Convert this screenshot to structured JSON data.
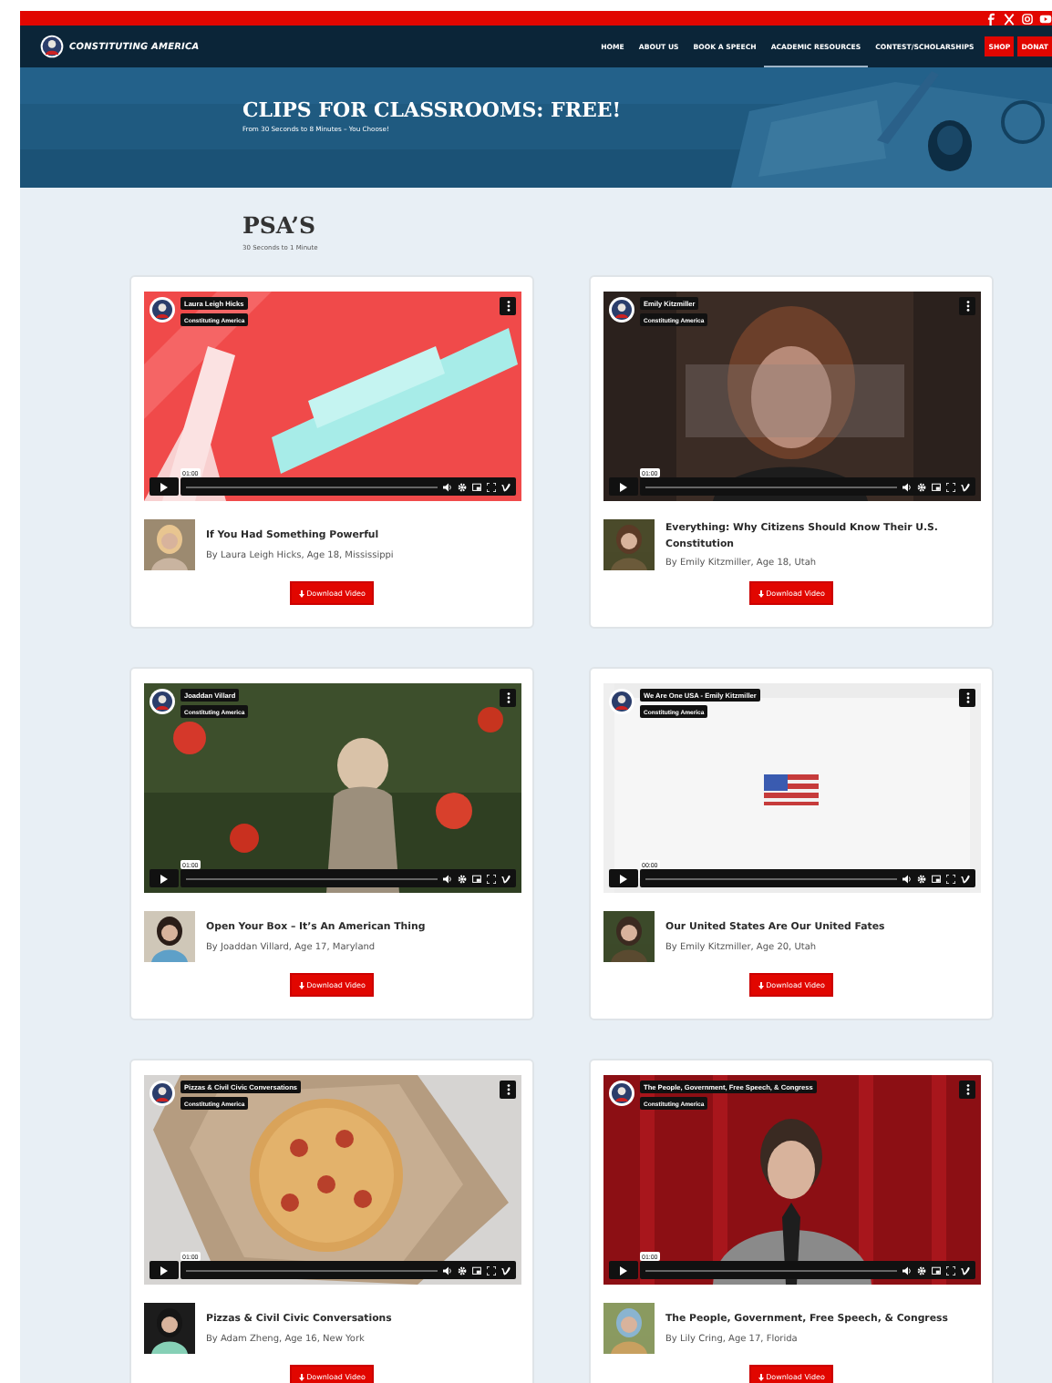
{
  "header": {
    "logo_text": "CONSTITUTING AMERICA",
    "nav": [
      {
        "label": "HOME",
        "selected": false,
        "kind": "link"
      },
      {
        "label": "ABOUT US",
        "selected": false,
        "kind": "link"
      },
      {
        "label": "BOOK A SPEECH",
        "selected": false,
        "kind": "link"
      },
      {
        "label": "ACADEMIC RESOURCES",
        "selected": true,
        "kind": "link"
      },
      {
        "label": "CONTEST/SCHOLARSHIPS",
        "selected": false,
        "kind": "link"
      },
      {
        "label": "SHOP",
        "selected": false,
        "kind": "button"
      },
      {
        "label": "DONAT",
        "selected": false,
        "kind": "button"
      }
    ]
  },
  "hero": {
    "title": "CLIPS FOR CLASSROOMS: FREE!",
    "subtitle": "From 30 Seconds to 8 Minutes – You Choose!"
  },
  "section": {
    "title": "PSA’S",
    "subtitle": "30 Seconds to 1 Minute"
  },
  "videos": [
    {
      "player_title": "Laura Leigh Hicks",
      "channel": "Constituting America",
      "time": "01:00",
      "title": "If You Had Something Powerful",
      "byline": "By Laura Leigh Hicks, Age 18, Mississippi",
      "button": "Download Video"
    },
    {
      "player_title": "Emily Kitzmiller",
      "channel": "Constituting America",
      "time": "01:00",
      "title": "Everything: Why Citizens Should Know Their U.S. Constitution",
      "byline": "By Emily Kitzmiller, Age 18, Utah",
      "button": "Download Video"
    },
    {
      "player_title": "Joaddan Villard",
      "channel": "Constituting America",
      "time": "01:00",
      "title": "Open Your Box – It’s An American Thing",
      "byline": "By Joaddan Villard, Age 17, Maryland",
      "button": "Download Video"
    },
    {
      "player_title": "We Are One USA - Emily Kitzmiller",
      "channel": "Constituting America",
      "time": "00:00",
      "title": "Our United States Are Our United Fates",
      "byline": "By Emily Kitzmiller, Age 20, Utah",
      "button": "Download Video"
    },
    {
      "player_title": "Pizzas & Civil Civic Conversations",
      "channel": "Constituting America",
      "time": "01:00",
      "title": "Pizzas & Civil Civic Conversations",
      "byline": "By Adam Zheng, Age 16, New York",
      "button": "Download Video"
    },
    {
      "player_title": "The People, Government, Free Speech, & Congress",
      "channel": "Constituting America",
      "time": "01:00",
      "title": "The People, Government, Free Speech, & Congress",
      "byline": "By Lily Cring, Age 17, Florida",
      "button": "Download Video"
    }
  ]
}
